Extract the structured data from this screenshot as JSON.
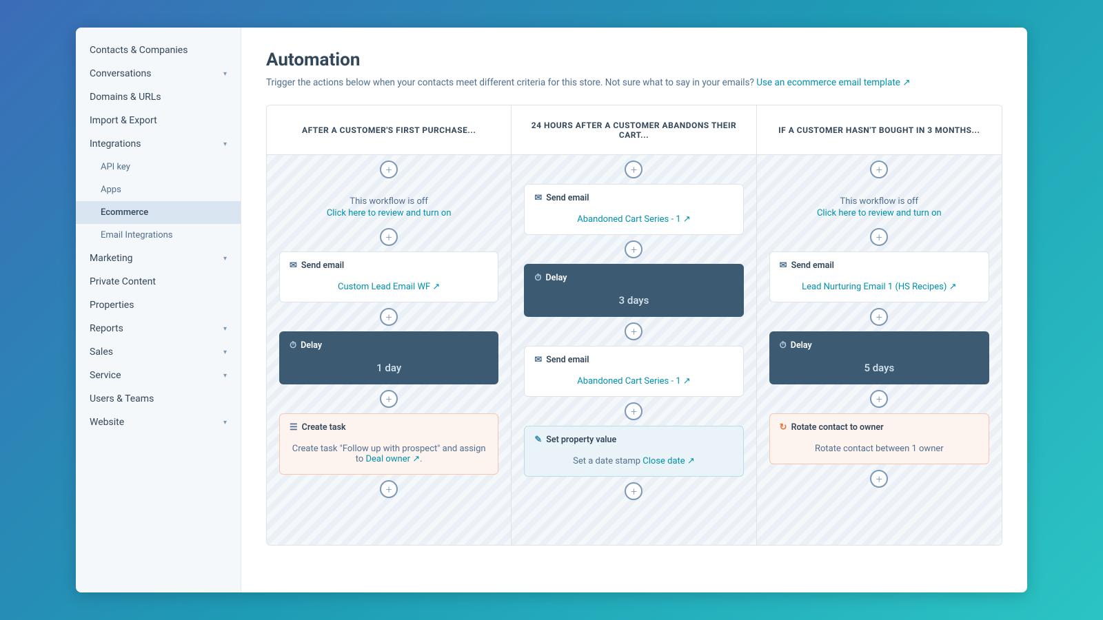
{
  "sidebar": {
    "items": [
      {
        "label": "Contacts & Companies",
        "hasChevron": false,
        "active": false
      },
      {
        "label": "Conversations",
        "hasChevron": true,
        "active": false
      },
      {
        "label": "Domains & URLs",
        "hasChevron": false,
        "active": false
      },
      {
        "label": "Import & Export",
        "hasChevron": false,
        "active": false
      },
      {
        "label": "Integrations",
        "hasChevron": true,
        "active": false
      },
      {
        "label": "API key",
        "sub": true,
        "active": false
      },
      {
        "label": "Apps",
        "sub": true,
        "active": false
      },
      {
        "label": "Ecommerce",
        "sub": true,
        "active": true
      },
      {
        "label": "Email Integrations",
        "sub": true,
        "active": false
      },
      {
        "label": "Marketing",
        "hasChevron": true,
        "active": false
      },
      {
        "label": "Private Content",
        "hasChevron": false,
        "active": false
      },
      {
        "label": "Properties",
        "hasChevron": false,
        "active": false
      },
      {
        "label": "Reports",
        "hasChevron": true,
        "active": false
      },
      {
        "label": "Sales",
        "hasChevron": true,
        "active": false
      },
      {
        "label": "Service",
        "hasChevron": true,
        "active": false
      },
      {
        "label": "Users & Teams",
        "hasChevron": false,
        "active": false
      },
      {
        "label": "Website",
        "hasChevron": true,
        "active": false
      }
    ]
  },
  "page": {
    "title": "Automation",
    "subtitle": "Trigger the actions below when your contacts meet different criteria for this store. Not sure what to say in your emails?",
    "subtitle_link": "Use an ecommerce email template ↗"
  },
  "columns": [
    {
      "header": "AFTER A CUSTOMER'S FIRST PURCHASE...",
      "workflow_off": true,
      "workflow_off_text": "This workflow is off",
      "workflow_turn_on": "Click here to review and turn on",
      "cards": [
        {
          "type": "send-email",
          "header_icon": "✉",
          "header_label": "Send email",
          "body_link": "Custom Lead Email WF ↗",
          "bg": "white"
        },
        {
          "type": "delay",
          "header_icon": "⏱",
          "header_label": "Delay",
          "body_text": "1 day",
          "bg": "dark"
        },
        {
          "type": "create-task",
          "header_icon": "☰",
          "header_label": "Create task",
          "body_text": "Create task \"Follow up with prospect\" and assign to ",
          "body_link": "Deal owner ↗",
          "body_suffix": ".",
          "bg": "pink"
        }
      ]
    },
    {
      "header": "24 HOURS AFTER A CUSTOMER ABANDONS THEIR CART...",
      "workflow_off": false,
      "cards": [
        {
          "type": "send-email",
          "header_icon": "✉",
          "header_label": "Send email",
          "body_link": "Abandoned Cart Series - 1 ↗",
          "bg": "white"
        },
        {
          "type": "delay",
          "header_icon": "⏱",
          "header_label": "Delay",
          "body_text": "3 days",
          "bg": "dark"
        },
        {
          "type": "send-email",
          "header_icon": "✉",
          "header_label": "Send email",
          "body_link": "Abandoned Cart Series - 1 ↗",
          "bg": "white"
        },
        {
          "type": "set-property",
          "header_icon": "✎",
          "header_label": "Set property value",
          "body_text": "Set a date stamp ",
          "body_link": "Close date ↗",
          "bg": "blue"
        }
      ]
    },
    {
      "header": "IF A CUSTOMER HASN'T BOUGHT IN 3 MONTHS...",
      "workflow_off": true,
      "workflow_off_text": "This workflow is off",
      "workflow_turn_on": "Click here to review and turn on",
      "cards": [
        {
          "type": "send-email",
          "header_icon": "✉",
          "header_label": "Send email",
          "body_link": "Lead Nurturing Email 1 (HS Recipes) ↗",
          "bg": "white"
        },
        {
          "type": "delay",
          "header_icon": "⏱",
          "header_label": "Delay",
          "body_text": "5 days",
          "bg": "dark"
        },
        {
          "type": "rotate-contact",
          "header_icon": "↻",
          "header_label": "Rotate contact to owner",
          "body_text": "Rotate contact between 1 owner",
          "bg": "pink"
        }
      ]
    }
  ]
}
